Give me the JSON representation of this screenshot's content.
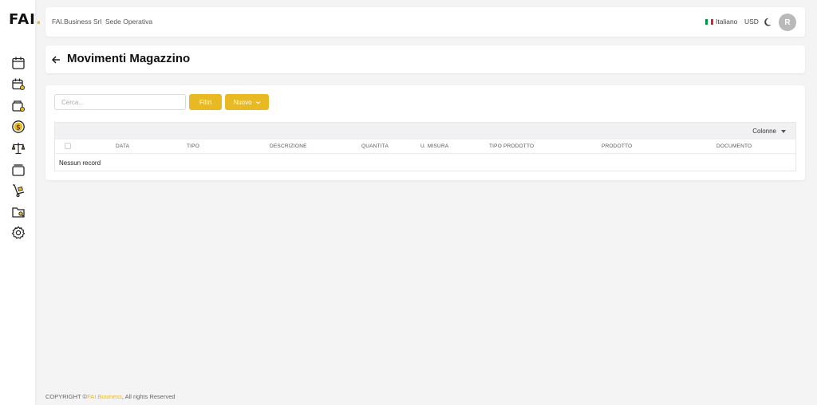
{
  "sidebar": {
    "logo_text": "FAI",
    "logo_dot": ".",
    "items": [
      {
        "name": "calendar-icon"
      },
      {
        "name": "calendar-user-icon"
      },
      {
        "name": "wallet-icon"
      },
      {
        "name": "dollar-icon"
      },
      {
        "name": "scale-icon"
      },
      {
        "name": "layers-icon"
      },
      {
        "name": "hand-truck-icon"
      },
      {
        "name": "folder-search-icon"
      },
      {
        "name": "gear-icon"
      }
    ]
  },
  "header": {
    "company": "FAI.Business Srl",
    "sede": "Sede Operativa",
    "language": "Italiano",
    "currency": "USD",
    "avatar_initial": "R"
  },
  "page": {
    "title": "Movimenti Magazzino"
  },
  "toolbar": {
    "search_placeholder": "Cerca...",
    "filter_label": "Filtri",
    "new_label": "Nuovo"
  },
  "table": {
    "columns_button": "Colonne",
    "headers": [
      "DATA",
      "TIPO",
      "DESCRIZIONE",
      "QUANTITA",
      "U. MISURA",
      "TIPO PRODOTTO",
      "PRODOTTO",
      "DOCUMENTO"
    ],
    "empty_text": "Nessun record"
  },
  "footer": {
    "prefix": "COPYRIGHT ©",
    "brand": "FAI.Business",
    "suffix": ", All rights Reserved"
  },
  "colors": {
    "accent": "#e8b923",
    "background": "#f4f4f5"
  }
}
